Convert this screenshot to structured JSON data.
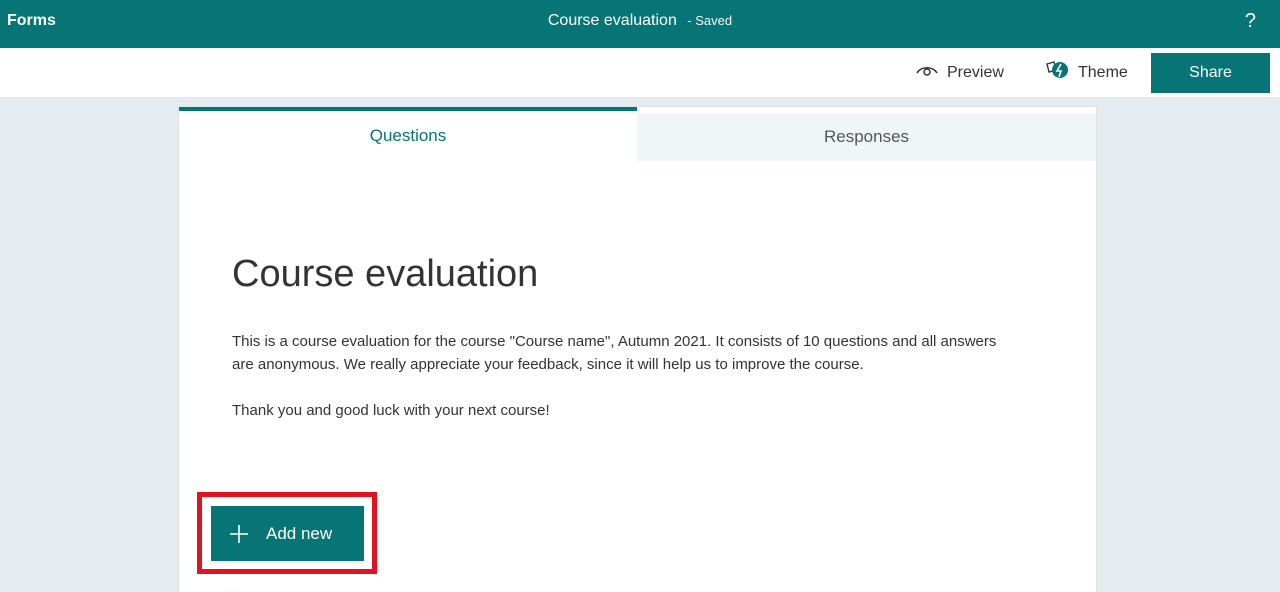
{
  "header": {
    "app_name": "Forms",
    "doc_title": "Course evaluation",
    "status": "- Saved",
    "help": "?"
  },
  "toolbar": {
    "preview_label": "Preview",
    "theme_label": "Theme",
    "share_label": "Share"
  },
  "tabs": [
    {
      "label": "Questions",
      "active": true
    },
    {
      "label": "Responses",
      "active": false
    }
  ],
  "form": {
    "title": "Course evaluation",
    "description_lines": [
      "This is a course evaluation for the course \"Course name\", Autumn 2021. It consists of 10 questions and all answers are anonymous. We really appreciate your feedback, since it will help us to improve the course.",
      "Thank you and good luck with your next course!"
    ],
    "add_new_label": "Add new"
  },
  "colors": {
    "brand": "#077575",
    "highlight": "#e0141e",
    "background": "#e4ecef"
  },
  "icons": {
    "preview": "eye-icon",
    "theme": "palette-icon",
    "add": "plus-icon"
  }
}
